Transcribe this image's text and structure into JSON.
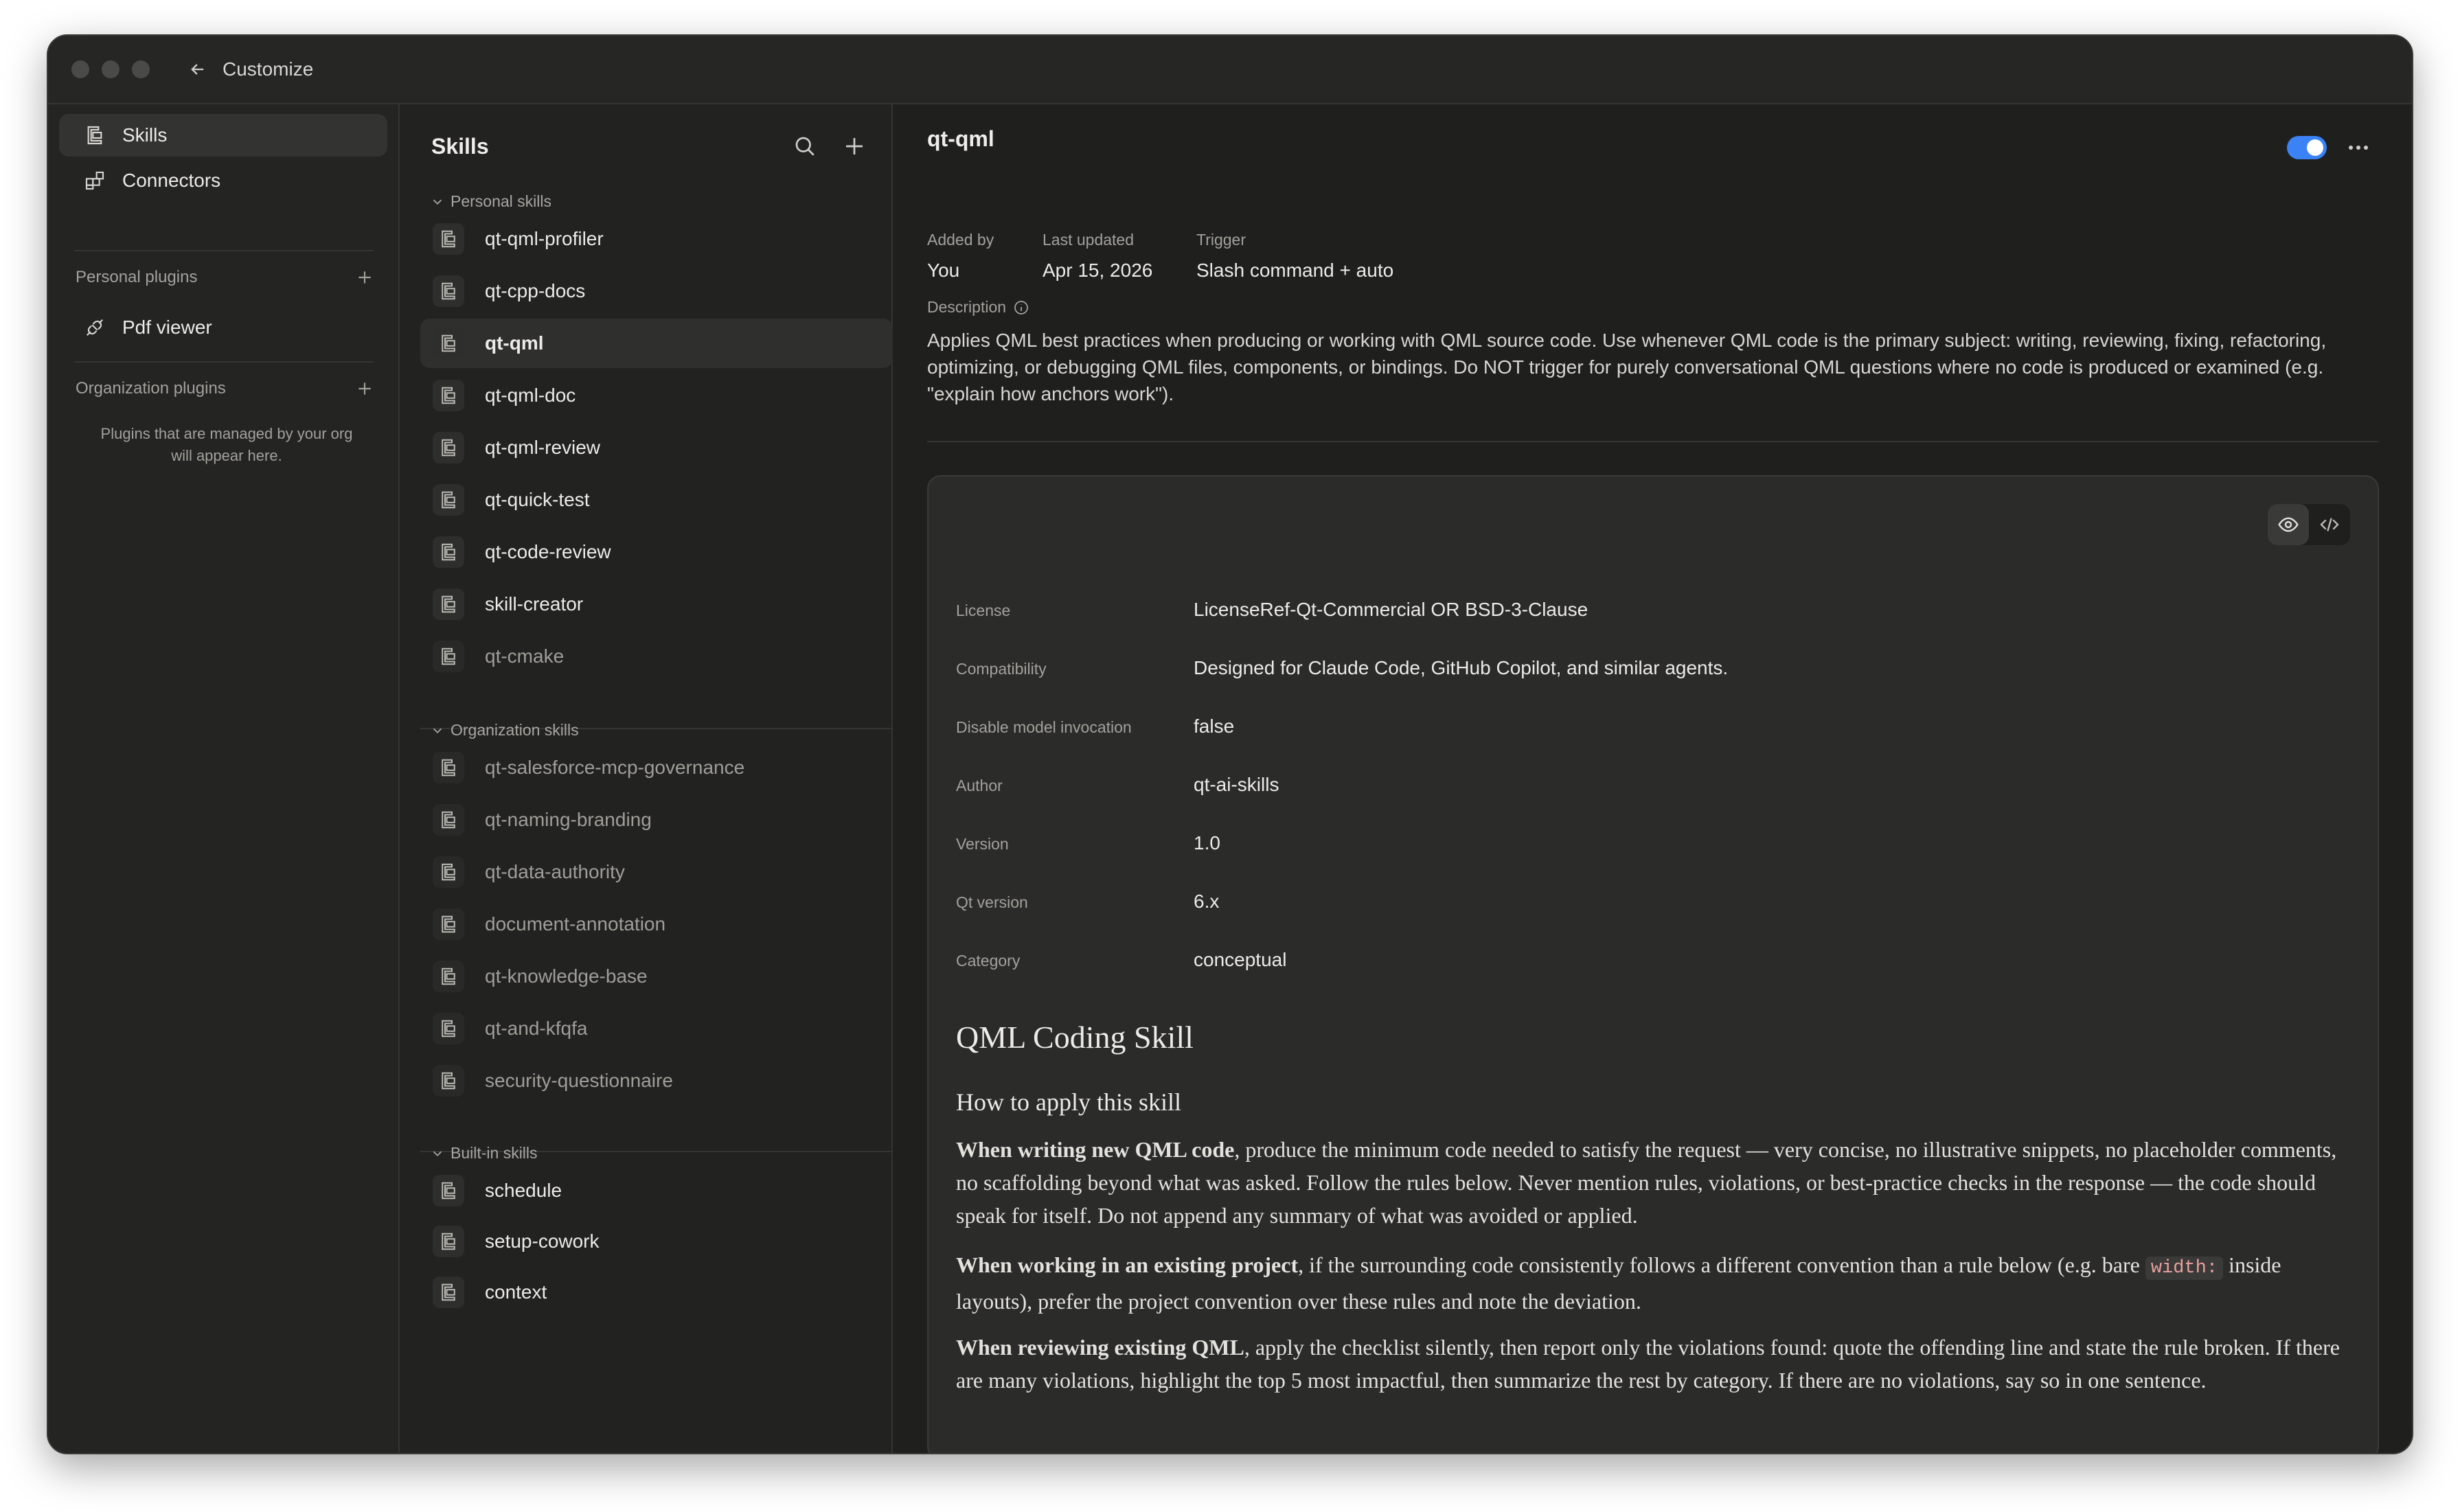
{
  "window": {
    "title": "Customize"
  },
  "sidebar": {
    "nav": [
      {
        "label": "Skills",
        "icon": "skill-icon",
        "active": true
      },
      {
        "label": "Connectors",
        "icon": "connectors-icon",
        "active": false
      }
    ],
    "personal_plugins": {
      "heading": "Personal plugins",
      "items": [
        {
          "label": "Pdf viewer",
          "icon": "plug-icon"
        }
      ]
    },
    "org_plugins": {
      "heading": "Organization plugins",
      "empty_note": "Plugins that are managed by your org will appear here."
    }
  },
  "skills_panel": {
    "title": "Skills",
    "groups": [
      {
        "label": "Personal skills",
        "items": [
          "qt-qml-profiler",
          "qt-cpp-docs",
          "qt-qml",
          "qt-qml-doc",
          "qt-qml-review",
          "qt-quick-test",
          "qt-code-review",
          "skill-creator",
          "qt-cmake"
        ]
      },
      {
        "label": "Organization skills",
        "items": [
          "qt-salesforce-mcp-governance",
          "qt-naming-branding",
          "qt-data-authority",
          "document-annotation",
          "qt-knowledge-base",
          "qt-and-kfqfa",
          "security-questionnaire"
        ]
      },
      {
        "label": "Built-in skills",
        "items": [
          "schedule",
          "setup-cowork",
          "context"
        ]
      }
    ],
    "selected": "qt-qml"
  },
  "detail": {
    "title": "qt-qml",
    "enabled": true,
    "meta": [
      {
        "label": "Added by",
        "value": "You"
      },
      {
        "label": "Last updated",
        "value": "Apr 15, 2026"
      },
      {
        "label": "Trigger",
        "value": "Slash command + auto"
      }
    ],
    "description_label": "Description",
    "description": "Applies QML best practices when producing or working with QML source code. Use whenever QML code is the primary subject: writing, reviewing, fixing, refactoring, optimizing, or debugging QML files, components, or bindings. Do NOT trigger for purely conversational QML questions where no code is produced or examined (e.g. \"explain how anchors work\").",
    "properties": [
      {
        "key": "License",
        "value": "LicenseRef-Qt-Commercial OR BSD-3-Clause"
      },
      {
        "key": "Compatibility",
        "value": "Designed for Claude Code, GitHub Copilot, and similar agents."
      },
      {
        "key": "Disable model invocation",
        "value": "false"
      },
      {
        "key": "Author",
        "value": "qt-ai-skills"
      },
      {
        "key": "Version",
        "value": "1.0"
      },
      {
        "key": "Qt version",
        "value": "6.x"
      },
      {
        "key": "Category",
        "value": "conceptual"
      }
    ],
    "markdown": {
      "h1": "QML Coding Skill",
      "h2": "How to apply this skill",
      "p1_bold": "When writing new QML code",
      "p1_rest": ", produce the minimum code needed to satisfy the request — very concise, no illustrative snippets, no placeholder comments, no scaffolding beyond what was asked. Follow the rules below. Never mention rules, violations, or best-practice checks in the response — the code should speak for itself. Do not append any summary of what was avoided or applied.",
      "p2_bold": "When working in an existing project",
      "p2_rest_a": ", if the surrounding code consistently follows a different convention than a rule below (e.g. bare ",
      "p2_code": "width:",
      "p2_rest_b": " inside layouts), prefer the project convention over these rules and note the deviation.",
      "p3_bold": "When reviewing existing QML",
      "p3_rest": ", apply the checklist silently, then report only the violations found: quote the offending line and state the rule broken. If there are many violations, highlight the top 5 most impactful, then summarize the rest by category. If there are no violations, say so in one sentence."
    }
  },
  "colors": {
    "accent": "#3b82f6",
    "background": "#1f1f1e"
  }
}
